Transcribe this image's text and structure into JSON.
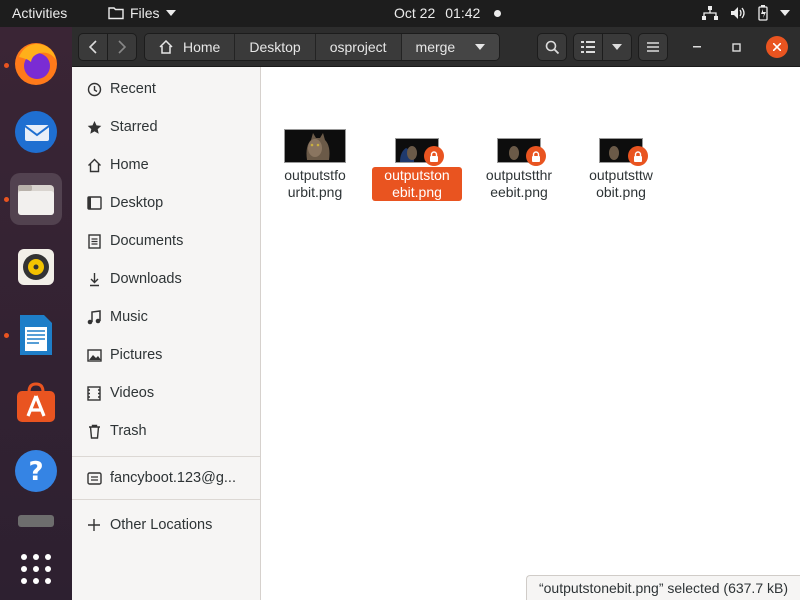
{
  "topbar": {
    "activities": "Activities",
    "app_menu": "Files",
    "date": "Oct 22",
    "time": "01:42"
  },
  "dock": {
    "items": [
      {
        "name": "firefox",
        "running": true
      },
      {
        "name": "thunderbird",
        "running": false
      },
      {
        "name": "files",
        "running": true,
        "active": true
      },
      {
        "name": "rhythmbox",
        "running": false
      },
      {
        "name": "libreoffice-writer",
        "running": true
      },
      {
        "name": "ubuntu-software",
        "running": false
      },
      {
        "name": "help",
        "running": false
      },
      {
        "name": "show-applications",
        "running": false
      }
    ]
  },
  "headerbar": {
    "back_icon": "chevron-left",
    "forward_icon": "chevron-right",
    "breadcrumbs": [
      "Home",
      "Desktop",
      "osproject",
      "merge"
    ],
    "search_icon": "search",
    "view_icon": "list-view",
    "menu_icon": "hamburger"
  },
  "sidebar": {
    "items": [
      {
        "label": "Recent",
        "icon": "clock"
      },
      {
        "label": "Starred",
        "icon": "star"
      },
      {
        "label": "Home",
        "icon": "home"
      },
      {
        "label": "Desktop",
        "icon": "desktop"
      },
      {
        "label": "Documents",
        "icon": "document"
      },
      {
        "label": "Downloads",
        "icon": "download"
      },
      {
        "label": "Music",
        "icon": "music"
      },
      {
        "label": "Pictures",
        "icon": "picture"
      },
      {
        "label": "Videos",
        "icon": "video"
      },
      {
        "label": "Trash",
        "icon": "trash"
      }
    ],
    "account": "fancyboot.123@g...",
    "other_locations": "Other Locations"
  },
  "files": [
    {
      "name_line1": "outputstfo",
      "name_line2": "urbit.png",
      "locked": false,
      "selected": false
    },
    {
      "name_line1": "outputston",
      "name_line2": "ebit.png",
      "locked": true,
      "selected": true
    },
    {
      "name_line1": "outputstthr",
      "name_line2": "eebit.png",
      "locked": true,
      "selected": false
    },
    {
      "name_line1": "outputsttw",
      "name_line2": "obit.png",
      "locked": true,
      "selected": false
    }
  ],
  "status": "“outputstonebit.png” selected  (637.7 kB)",
  "colors": {
    "accent": "#e95420",
    "topbar": "#1d1d1d",
    "headerbar": "#2d2d2d"
  }
}
